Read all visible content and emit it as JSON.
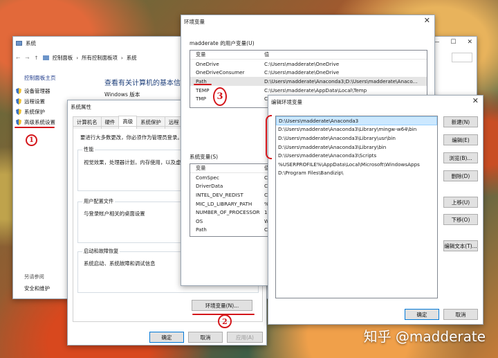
{
  "system_window": {
    "title": "系统",
    "breadcrumb": [
      "控制面板",
      "所有控制面板项",
      "系统"
    ],
    "sidebar_home": "控制面板主页",
    "sidebar_items": [
      "设备管理器",
      "远程设置",
      "系统保护",
      "高级系统设置"
    ],
    "see_also": "另请参阅",
    "security": "安全和维护",
    "heading": "查看有关计算机的基本信息",
    "windows_edition": "Windows 版本",
    "annotation_1": "1"
  },
  "sysprops": {
    "title": "系统属性",
    "tabs": [
      "计算机名",
      "硬件",
      "高级",
      "系统保护",
      "远程"
    ],
    "admin_note": "要进行大多数更改，你必须作为管理员登录。",
    "performance_title": "性能",
    "performance_desc": "视觉效果，处理器计划，内存使用，以及虚拟内存",
    "profile_title": "用户配置文件",
    "profile_desc": "与登录帐户相关的桌面设置",
    "startup_title": "启动和故障恢复",
    "startup_desc": "系统启动、系统故障和调试信息",
    "env_button": "环境变量(N)...",
    "ok": "确定",
    "cancel": "取消",
    "apply": "应用(A)",
    "annotation_2": "2"
  },
  "envvars": {
    "title": "环境变量",
    "user_group": "madderate 的用户变量(U)",
    "col_var": "变量",
    "col_val": "值",
    "user_vars": [
      {
        "name": "OneDrive",
        "value": "C:\\Users\\madderate\\OneDrive"
      },
      {
        "name": "OneDriveConsumer",
        "value": "C:\\Users\\madderate\\OneDrive"
      },
      {
        "name": "Path",
        "value": "D:\\Users\\madderate\\Anaconda3;D:\\Users\\madderate\\Anaco..."
      },
      {
        "name": "TEMP",
        "value": "C:\\Users\\madderate\\AppData\\Local\\Temp"
      },
      {
        "name": "TMP",
        "value": "C"
      }
    ],
    "system_group": "系统变量(S)",
    "system_vars": [
      {
        "name": "ComSpec",
        "value": "C"
      },
      {
        "name": "DriverData",
        "value": "C"
      },
      {
        "name": "INTEL_DEV_REDIST",
        "value": "C"
      },
      {
        "name": "MIC_LD_LIBRARY_PATH",
        "value": "%"
      },
      {
        "name": "NUMBER_OF_PROCESSORS",
        "value": "1"
      },
      {
        "name": "OS",
        "value": "W"
      },
      {
        "name": "Path",
        "value": "C"
      }
    ],
    "col_val_short": "值",
    "annotation_3": "3"
  },
  "editenv": {
    "title": "编辑环境变量",
    "entries": [
      "D:\\Users\\madderate\\Anaconda3",
      "D:\\Users\\madderate\\Anaconda3\\Library\\mingw-w64\\bin",
      "D:\\Users\\madderate\\Anaconda3\\Library\\usr\\bin",
      "D:\\Users\\madderate\\Anaconda3\\Library\\bin",
      "D:\\Users\\madderate\\Anaconda3\\Scripts",
      "%USERPROFILE%\\AppData\\Local\\Microsoft\\WindowsApps",
      "D:\\Program Files\\Bandizip\\"
    ],
    "new": "新建(N)",
    "edit": "编辑(E)",
    "browse": "浏览(B)...",
    "delete": "删除(D)",
    "up": "上移(U)",
    "down": "下移(O)",
    "edit_text": "编辑文本(T)...",
    "ok": "确定",
    "cancel": "取消"
  },
  "watermark": "知乎 @madderate"
}
